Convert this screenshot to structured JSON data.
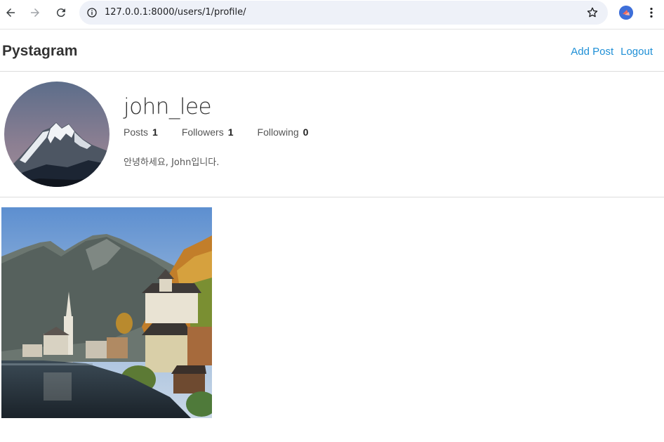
{
  "browser": {
    "url": "127.0.0.1:8000/users/1/profile/",
    "icons": [
      "back-icon",
      "forward-icon",
      "reload-icon",
      "site-info-icon",
      "bookmark-star-icon",
      "profile-avatar-icon",
      "more-menu-icon"
    ]
  },
  "header": {
    "brand": "Pystagram",
    "nav": {
      "add_post": "Add Post",
      "logout": "Logout"
    },
    "link_color": "#1e8fd6"
  },
  "profile": {
    "username": "john_lee",
    "stats": {
      "posts_label": "Posts",
      "posts_value": "1",
      "followers_label": "Followers",
      "followers_value": "1",
      "following_label": "Following",
      "following_value": "0"
    },
    "bio": "안녕하세요, John입니다."
  },
  "posts": [
    {
      "image": "mountain-lake-village-photo"
    }
  ]
}
